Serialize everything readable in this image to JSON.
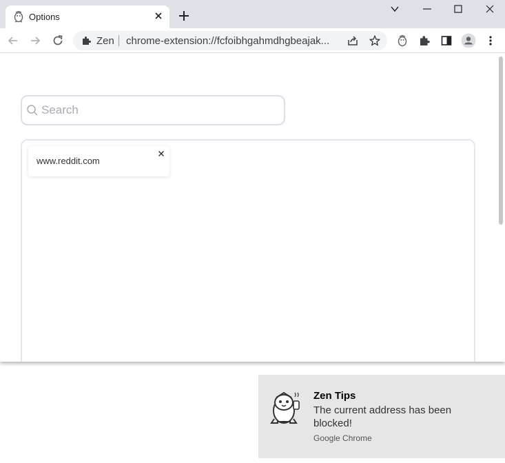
{
  "tab": {
    "title": "Options",
    "favicon": "zen-penguin-icon"
  },
  "toolbar": {
    "chip_label": "Zen",
    "url": "chrome-extension://fcfoibhgahmdhgbeajak..."
  },
  "search": {
    "placeholder": "Search",
    "value": ""
  },
  "blocked_sites": [
    {
      "label": "www.reddit.com"
    }
  ],
  "notification": {
    "title": "Zen Tips",
    "body": "The current address has been blocked!",
    "source": "Google Chrome"
  }
}
